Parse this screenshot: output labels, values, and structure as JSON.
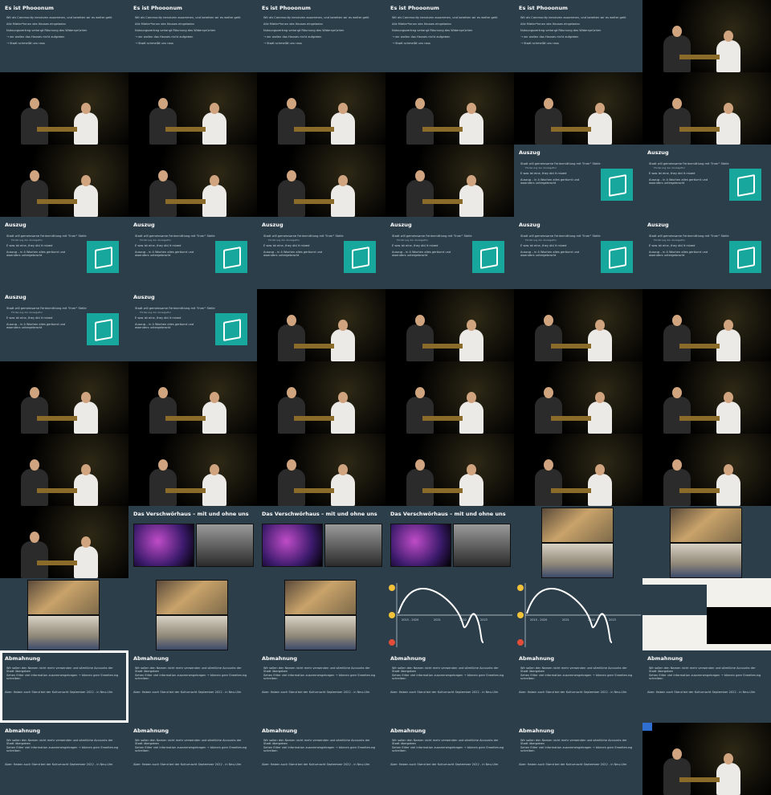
{
  "tiles": [
    {
      "type": "slide",
      "title": "Es ist Phooonum",
      "lines": [
        "Wir als Community benutzen zusammen, und bereiten wir es weiter geht",
        "Alle Mieter*innen des Hauses eingeladen",
        "Nutzungsvertrag verlangt Räumung des Widersprüchen",
        "→ wir wollen das Hauses nicht aufgeben",
        "→ Stadt schmeißt uns raus"
      ]
    },
    {
      "type": "slide",
      "title": "Es ist Phooonum",
      "lines": [
        "Wir als Community benutzen zusammen, und bereiten wir es weiter geht",
        "Alle Mieter*innen des Hauses eingeladen",
        "Nutzungsvertrag verlangt Räumung des Widersprüchen",
        "→ wir wollen das Hauses nicht aufgeben",
        "→ Stadt schmeißt uns raus"
      ]
    },
    {
      "type": "slide",
      "title": "Es ist Phooonum",
      "lines": [
        "Wir als Community benutzen zusammen, und bereiten wir es weiter geht",
        "Alle Mieter*innen des Hauses eingeladen",
        "Nutzungsvertrag verlangt Räumung des Widersprüchen",
        "→ wir wollen das Hauses nicht aufgeben",
        "→ Stadt schmeißt uns raus"
      ]
    },
    {
      "type": "slide",
      "title": "Es ist Phooonum",
      "lines": [
        "Wir als Community benutzen zusammen, und bereiten wir es weiter geht",
        "Alle Mieter*innen des Hauses eingeladen",
        "Nutzungsvertrag verlangt Räumung des Widersprüchen",
        "→ wir wollen das Hauses nicht aufgeben",
        "→ Stadt schmeißt uns raus"
      ]
    },
    {
      "type": "slide",
      "title": "Es ist Phooonum",
      "lines": [
        "Wir als Community benutzen zusammen, und bereiten wir es weiter geht",
        "Alle Mieter*innen des Hauses eingeladen",
        "Nutzungsvertrag verlangt Räumung des Widersprüchen",
        "→ wir wollen das Hauses nicht aufgeben",
        "→ Stadt schmeißt uns raus"
      ]
    },
    {
      "type": "stage"
    },
    {
      "type": "stage"
    },
    {
      "type": "stage"
    },
    {
      "type": "stage"
    },
    {
      "type": "stage"
    },
    {
      "type": "stage"
    },
    {
      "type": "stage"
    },
    {
      "type": "stage"
    },
    {
      "type": "stage"
    },
    {
      "type": "stage"
    },
    {
      "type": "stage"
    },
    {
      "type": "auszug",
      "title": "Auszug",
      "lines": [
        "Stadt will gemeinsame Ferienmittlung mit \"Ihrer\" Stelle",
        "Auszug – in 4 Wochen alles geräumt und woanders untergebracht"
      ],
      "sub": "Förderung der Anzeigeflur",
      "mid": "E was ist eine, they did it mixed"
    },
    {
      "type": "auszug",
      "title": "Auszug",
      "lines": [
        "Stadt will gemeinsame Ferienmittlung mit \"Ihrer\" Stelle",
        "Auszug – in 4 Wochen alles geräumt und woanders untergebracht"
      ],
      "sub": "Förderung der Anzeigeflur",
      "mid": "E was ist eine, they did it mixed"
    },
    {
      "type": "auszug",
      "title": "Auszug",
      "lines": [
        "Stadt will gemeinsame Ferienmittlung mit \"Ihrer\" Stelle",
        "Auszug – in 4 Wochen alles geräumt und woanders untergebracht"
      ],
      "sub": "Förderung der Anzeigeflur",
      "mid": "E was ist eine, they did it mixed"
    },
    {
      "type": "auszug",
      "title": "Auszug",
      "lines": [
        "Stadt will gemeinsame Ferienmittlung mit \"Ihrer\" Stelle",
        "Auszug – in 4 Wochen alles geräumt und woanders untergebracht"
      ],
      "sub": "Förderung der Anzeigeflur",
      "mid": "E was ist eine, they did it mixed"
    },
    {
      "type": "auszug",
      "title": "Auszug",
      "lines": [
        "Stadt will gemeinsame Ferienmittlung mit \"Ihrer\" Stelle",
        "Auszug – in 4 Wochen alles geräumt und woanders untergebracht"
      ],
      "sub": "Förderung der Anzeigeflur",
      "mid": "E was ist eine, they did it mixed"
    },
    {
      "type": "auszug",
      "title": "Auszug",
      "lines": [
        "Stadt will gemeinsame Ferienmittlung mit \"Ihrer\" Stelle",
        "Auszug – in 4 Wochen alles geräumt und woanders untergebracht"
      ],
      "sub": "Förderung der Anzeigeflur",
      "mid": "E was ist eine, they did it mixed"
    },
    {
      "type": "auszug",
      "title": "Auszug",
      "lines": [
        "Stadt will gemeinsame Ferienmittlung mit \"Ihrer\" Stelle",
        "Auszug – in 4 Wochen alles geräumt und woanders untergebracht"
      ],
      "sub": "Förderung der Anzeigeflur",
      "mid": "E was ist eine, they did it mixed"
    },
    {
      "type": "auszug",
      "title": "Auszug",
      "lines": [
        "Stadt will gemeinsame Ferienmittlung mit \"Ihrer\" Stelle",
        "Auszug – in 4 Wochen alles geräumt und woanders untergebracht"
      ],
      "sub": "Förderung der Anzeigeflur",
      "mid": "E was ist eine, they did it mixed"
    },
    {
      "type": "auszug",
      "title": "Auszug",
      "lines": [
        "Stadt will gemeinsame Ferienmittlung mit \"Ihrer\" Stelle",
        "Auszug – in 4 Wochen alles geräumt und woanders untergebracht"
      ],
      "sub": "Förderung der Anzeigeflur",
      "mid": "E was ist eine, they did it mixed"
    },
    {
      "type": "auszug",
      "title": "Auszug",
      "lines": [
        "Stadt will gemeinsame Ferienmittlung mit \"Ihrer\" Stelle",
        "Auszug – in 4 Wochen alles geräumt und woanders untergebracht"
      ],
      "sub": "Förderung der Anzeigeflur",
      "mid": "E was ist eine, they did it mixed"
    },
    {
      "type": "stage"
    },
    {
      "type": "stage"
    },
    {
      "type": "stage"
    },
    {
      "type": "stage"
    },
    {
      "type": "stage"
    },
    {
      "type": "stage"
    },
    {
      "type": "stage"
    },
    {
      "type": "stage"
    },
    {
      "type": "stage"
    },
    {
      "type": "stage"
    },
    {
      "type": "stage"
    },
    {
      "type": "stage"
    },
    {
      "type": "stage"
    },
    {
      "type": "stage"
    },
    {
      "type": "stage"
    },
    {
      "type": "stage"
    },
    {
      "type": "stage"
    },
    {
      "type": "photos2",
      "title": "Das Verschwörhaus – mit und ohne uns"
    },
    {
      "type": "photos2",
      "title": "Das Verschwörhaus – mit und ohne uns"
    },
    {
      "type": "photos2",
      "title": "Das Verschwörhaus – mit und ohne uns"
    },
    {
      "type": "photos3"
    },
    {
      "type": "photos3"
    },
    {
      "type": "photos3"
    },
    {
      "type": "photos3"
    },
    {
      "type": "photos3"
    },
    {
      "type": "chart",
      "years": [
        "2015 - 2020",
        "2021",
        "2022",
        "2023"
      ]
    },
    {
      "type": "chart",
      "years": [
        "2015 - 2020",
        "2021",
        "2022",
        "2023"
      ]
    },
    {
      "type": "mixed"
    },
    {
      "type": "abm",
      "selected": true,
      "title": "Abmahnung",
      "lines": [
        "Wir sollen den Namen nicht mehr verwenden und sämtliche Accounts der Stadt übergeben",
        "Sehen Eilter viel Information zusammengetragen → können gern Erweiterung schreiben"
      ],
      "footer": "Aber: Haben auch Stand bei der Kulturnacht September 2022 - in Neu-Ulm"
    },
    {
      "type": "abm",
      "title": "Abmahnung",
      "lines": [
        "Wir sollen den Namen nicht mehr verwenden und sämtliche Accounts der Stadt übergeben",
        "Sehen Eilter viel Information zusammengetragen → können gern Erweiterung schreiben"
      ],
      "footer": "Aber: Haben auch Stand bei der Kulturnacht September 2022 - in Neu-Ulm"
    },
    {
      "type": "abm",
      "title": "Abmahnung",
      "lines": [
        "Wir sollen den Namen nicht mehr verwenden und sämtliche Accounts der Stadt übergeben",
        "Sehen Eilter viel Information zusammengetragen → können gern Erweiterung schreiben"
      ],
      "footer": "Aber: Haben auch Stand bei der Kulturnacht September 2022 - in Neu-Ulm"
    },
    {
      "type": "abm",
      "title": "Abmahnung",
      "lines": [
        "Wir sollen den Namen nicht mehr verwenden und sämtliche Accounts der Stadt übergeben",
        "Sehen Eilter viel Information zusammengetragen → können gern Erweiterung schreiben"
      ],
      "footer": "Aber: Haben auch Stand bei der Kulturnacht September 2022 - in Neu-Ulm"
    },
    {
      "type": "abm",
      "title": "Abmahnung",
      "lines": [
        "Wir sollen den Namen nicht mehr verwenden und sämtliche Accounts der Stadt übergeben",
        "Sehen Eilter viel Information zusammengetragen → können gern Erweiterung schreiben"
      ],
      "footer": "Aber: Haben auch Stand bei der Kulturnacht September 2022 - in Neu-Ulm"
    },
    {
      "type": "abm",
      "title": "Abmahnung",
      "lines": [
        "Wir sollen den Namen nicht mehr verwenden und sämtliche Accounts der Stadt übergeben",
        "Sehen Eilter viel Information zusammengetragen → können gern Erweiterung schreiben"
      ],
      "footer": "Aber: Haben auch Stand bei der Kulturnacht September 2022 - in Neu-Ulm"
    },
    {
      "type": "abm",
      "title": "Abmahnung",
      "lines": [
        "Wir sollen den Namen nicht mehr verwenden und sämtliche Accounts der Stadt übergeben",
        "Sehen Eilter viel Information zusammengetragen → können gern Erweiterung schreiben"
      ],
      "footer": "Aber: Haben auch Stand bei der Kulturnacht September 2022 - in Neu-Ulm"
    },
    {
      "type": "abm",
      "title": "Abmahnung",
      "lines": [
        "Wir sollen den Namen nicht mehr verwenden und sämtliche Accounts der Stadt übergeben",
        "Sehen Eilter viel Information zusammengetragen → können gern Erweiterung schreiben"
      ],
      "footer": "Aber: Haben auch Stand bei der Kulturnacht September 2022 - in Neu-Ulm"
    },
    {
      "type": "abm",
      "title": "Abmahnung",
      "lines": [
        "Wir sollen den Namen nicht mehr verwenden und sämtliche Accounts der Stadt übergeben",
        "Sehen Eilter viel Information zusammengetragen → können gern Erweiterung schreiben"
      ],
      "footer": "Aber: Haben auch Stand bei der Kulturnacht September 2022 - in Neu-Ulm"
    },
    {
      "type": "abm",
      "title": "Abmahnung",
      "lines": [
        "Wir sollen den Namen nicht mehr verwenden und sämtliche Accounts der Stadt übergeben",
        "Sehen Eilter viel Information zusammengetragen → können gern Erweiterung schreiben"
      ],
      "footer": "Aber: Haben auch Stand bei der Kulturnacht September 2022 - in Neu-Ulm"
    },
    {
      "type": "abm",
      "title": "Abmahnung",
      "lines": [
        "Wir sollen den Namen nicht mehr verwenden und sämtliche Accounts der Stadt übergeben",
        "Sehen Eilter viel Information zusammengetragen → können gern Erweiterung schreiben"
      ],
      "footer": "Aber: Haben auch Stand bei der Kulturnacht September 2022 - in Neu-Ulm"
    },
    {
      "type": "stage",
      "blueMark": true
    }
  ]
}
